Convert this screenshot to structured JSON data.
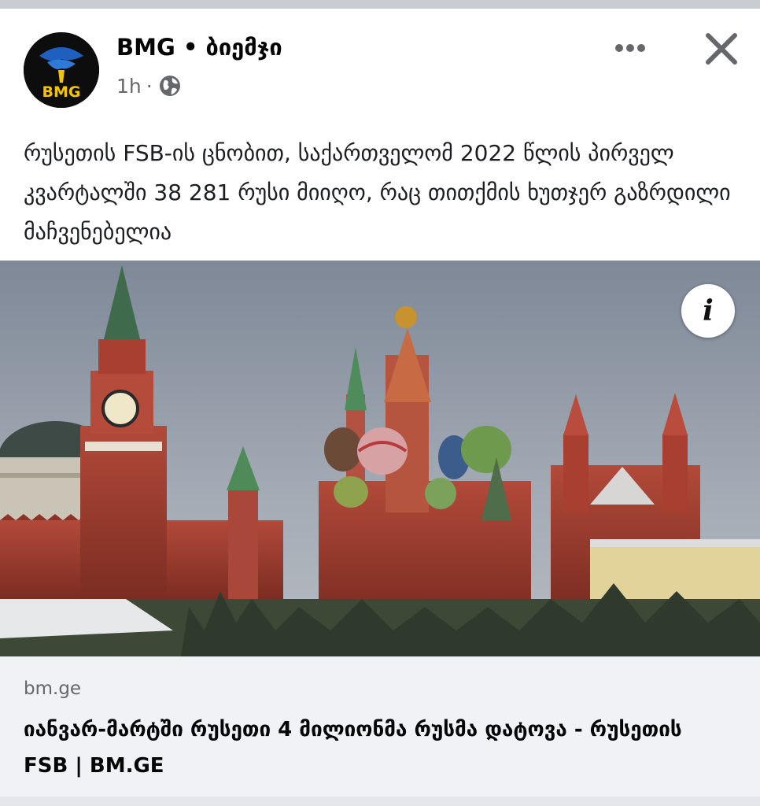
{
  "post": {
    "page_name": "BMG • ბიემჯი",
    "time": "1h",
    "separator": "·",
    "audience_icon": "globe-icon",
    "text": "რუსეთის FSB-ის ცნობით, საქართველომ 2022 წლის პირველ კვარტალში 38 281 რუსი მიიღო, რაც თითქმის ხუთჯერ გაზრდილი მაჩვენებელია",
    "avatar_text": "BMG",
    "info_label": "i"
  },
  "link_preview": {
    "domain": "bm.ge",
    "title": "იანვარ-მარტში რუსეთი 4 მილიონმა რუსმა დატოვა - რუსეთის FSB | BM.GE"
  },
  "colors": {
    "secondary_text": "#65676b",
    "preview_bg": "#f0f2f5",
    "avatar_bg": "#0d0d0d",
    "avatar_text": "#f5c400",
    "avatar_logo": "#1f5fbf"
  }
}
